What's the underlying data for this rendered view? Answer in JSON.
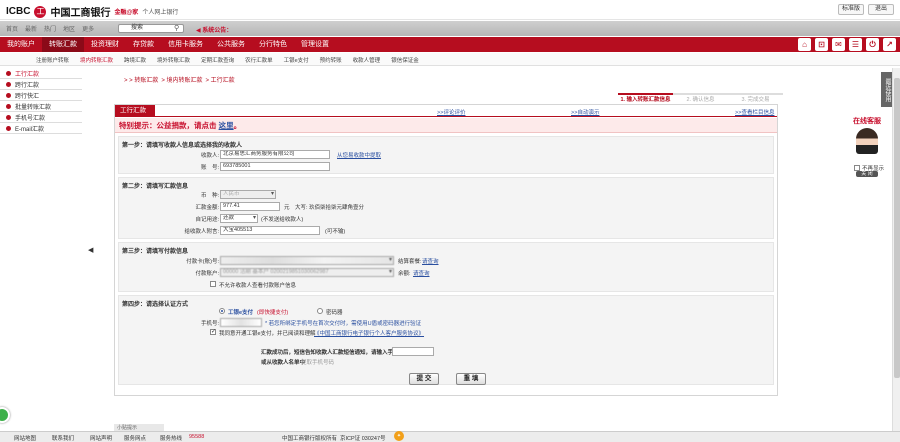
{
  "header": {
    "logo_text": "ICBC",
    "logo_seal": "工",
    "bank_name": "中国工商银行",
    "tag": "金融@家",
    "subtitle": "个人网上银行",
    "btn_std": "标准版",
    "btn_exit": "退出"
  },
  "greybar": {
    "links": [
      "首页",
      "最新",
      "热门",
      "地区",
      "更多"
    ],
    "search_text": "搜索",
    "notice": "◀ 系统公告："
  },
  "nav": {
    "items": [
      "我的账户",
      "转账汇款",
      "投资理财",
      "存贷款",
      "信用卡服务",
      "公共服务",
      "分行特色",
      "管理设置"
    ],
    "active_index": 1
  },
  "subnav": {
    "items": [
      "注册账户转账",
      "境内转账汇款",
      "跨境汇款",
      "境外转账汇款",
      "定期汇款查询",
      "农行汇款单",
      "工银e支付",
      "预约转账",
      "收款人管理",
      "银信保证金"
    ],
    "active_index": 1
  },
  "sidebar": {
    "items": [
      "工行汇款",
      "跨行汇款",
      "跨行快汇",
      "批量转账汇款",
      "手机号汇款",
      "E-mail汇款"
    ],
    "active_index": 0
  },
  "breadcrumb": [
    "> > 转账汇款",
    "> 境内转账汇款",
    "> 工行汇款"
  ],
  "steps": [
    "1. 输入转账汇款信息",
    "2. 确认信息",
    "3. 完成交易"
  ],
  "panel": {
    "tab": "工行汇款",
    "link_eval": "评论评价",
    "link_demo": "自动演示",
    "link_help": "查看栏目信息",
    "special_text": "特别提示：公益捐款，请点击 ",
    "special_link": "这里",
    "special_end": "。"
  },
  "step1": {
    "title": "第一步：请填写收款人信息或选择我的收款人",
    "payee_label": "收款人:",
    "payee_value": "北京易思汇商务服务有限公司",
    "payee_link": "从您易收款中提取",
    "account_label": "账　号:",
    "account_value": "693785001"
  },
  "step2": {
    "title": "第二步：请填写汇款信息",
    "currency_label": "币　种:",
    "currency_value": "人民币",
    "amount_label": "汇款金额:",
    "amount_value": "977.41",
    "amount_unit": "元",
    "amount_caps": "大写: 玖佰柒拾柒元肆角壹分",
    "purpose_label": "自记用途:",
    "purpose_value": "还款",
    "purpose_note": "(不发送给收款人)",
    "postscript_label": "给收款人附言:",
    "postscript_value": "大宝405513",
    "postscript_note": "(可不输)"
  },
  "step3": {
    "title": "第三步：请填写付款信息",
    "card_label": "付款卡(账)号:",
    "card_value": "",
    "card_aux": "结算套餐:",
    "card_aux_link": "请查询",
    "account_label": "付款账户:",
    "account_value": "00000 活期 基本户 0200219851030062987",
    "balance_label": "余额:",
    "balance_link": "请查询",
    "no_view_label": "不允许收款人查看付款账户信息"
  },
  "step4": {
    "title": "第四步：请选择认证方式",
    "option1": "工银e支付",
    "option1_note": "(即快捷支付)",
    "option2": "密码器",
    "phone_label": "手机号:",
    "phone_value": "",
    "phone_note": "* 若您所绑定手机号在首次交付时，需使用U盾或密码器进行验证",
    "agree_label": "我同意开通工银e支付，并已阅读和理解",
    "agree_link": "《中国工商银行电子银行个人客户服务协议》",
    "notify_text": "汇款成功后，短信告知收款人汇款短信通知，请输入手机号码：",
    "notify_text2": "或从收款人名单中",
    "notify_link": "提取手机号码",
    "submit": "提 交",
    "reset": "重 填"
  },
  "service": {
    "title": "在线客服",
    "dont_show": "不再显示",
    "close": "关 闭"
  },
  "vtab": "最近使用",
  "bottom_tab": "小贴提示",
  "footer": {
    "items": [
      "网站地图",
      "联系我们",
      "网站声明",
      "服务网点",
      "服务热线"
    ],
    "hotline": "95588",
    "copyright": "中国工商银行版权所有",
    "icp": "京ICP证 030247号"
  }
}
